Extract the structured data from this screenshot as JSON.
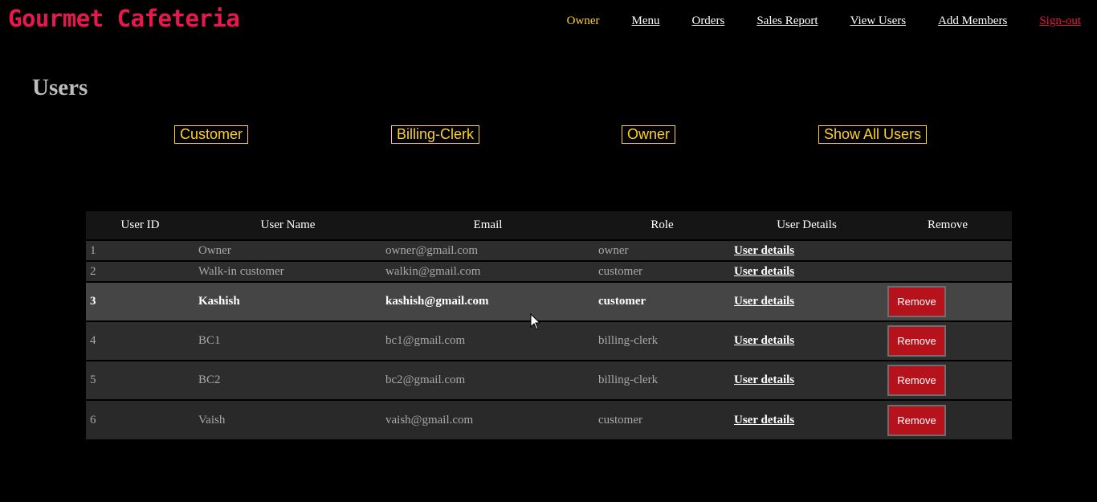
{
  "header": {
    "brand": "Gourmet Cafeteria",
    "nav": [
      "Owner",
      "Menu",
      "Orders",
      "Sales Report",
      "View Users",
      "Add Members",
      "Sign-out"
    ]
  },
  "page_title": "Users",
  "filters": [
    "Customer",
    "Billing-Clerk",
    "Owner",
    "Show All Users"
  ],
  "table": {
    "columns": [
      "User ID",
      "User Name",
      "Email",
      "Role",
      "User Details",
      "Remove"
    ],
    "rows": [
      {
        "id": "1",
        "name": "Owner",
        "email": "owner@gmail.com",
        "role": "owner",
        "details": "User details",
        "remove": ""
      },
      {
        "id": "2",
        "name": "Walk-in customer",
        "email": "walkin@gmail.com",
        "role": "customer",
        "details": "User details",
        "remove": ""
      },
      {
        "id": "3",
        "name": "Kashish",
        "email": "kashish@gmail.com",
        "role": "customer",
        "details": "User details",
        "remove": "Remove"
      },
      {
        "id": "4",
        "name": "BC1",
        "email": "bc1@gmail.com",
        "role": "billing-clerk",
        "details": "User details",
        "remove": "Remove"
      },
      {
        "id": "5",
        "name": "BC2",
        "email": "bc2@gmail.com",
        "role": "billing-clerk",
        "details": "User details",
        "remove": "Remove"
      },
      {
        "id": "6",
        "name": "Vaish",
        "email": "vaish@gmail.com",
        "role": "customer",
        "details": "User details",
        "remove": "Remove"
      }
    ]
  },
  "colors": {
    "brand": "#e8174d",
    "accent": "#ffd21f",
    "remove_button": "#b5121b",
    "row": "#2e2d2d",
    "row_hover": "#464545"
  }
}
